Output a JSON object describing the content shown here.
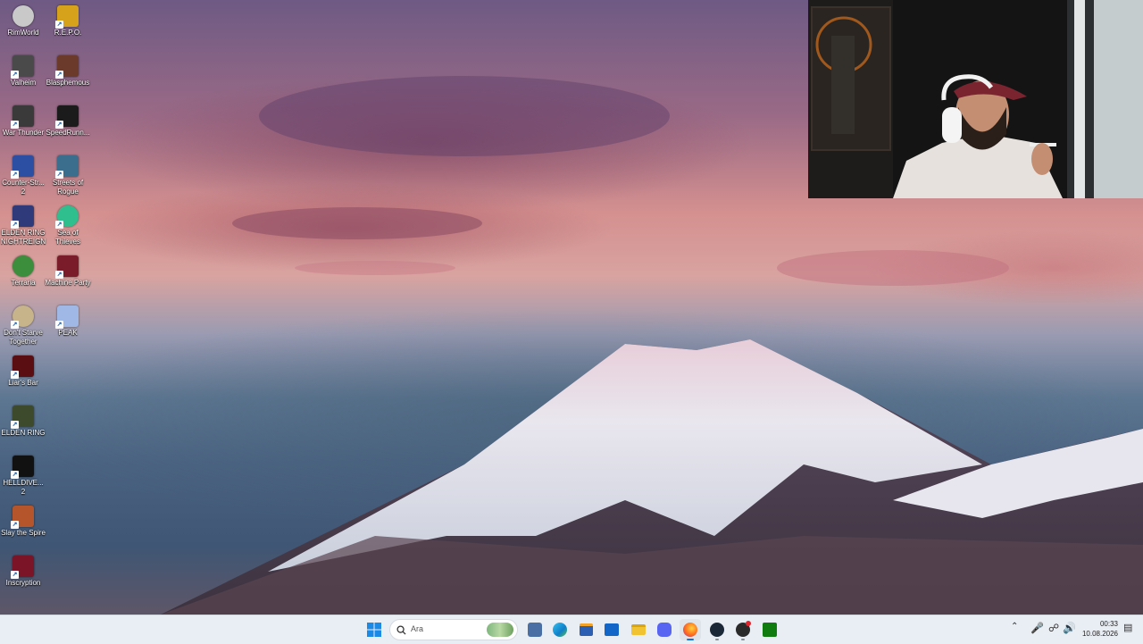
{
  "desktop": {
    "icons": [
      {
        "label": "RimWorld",
        "icon": "rimworld-icon",
        "color": "#c9c9c9"
      },
      {
        "label": "R.E.P.O.",
        "icon": "repo-icon",
        "color": "#d6a21c"
      },
      {
        "label": "Valheim",
        "icon": "valheim-icon",
        "color": "#4a4a4a"
      },
      {
        "label": "Blasphemous",
        "icon": "blasphemous-icon",
        "color": "#6b3a2a"
      },
      {
        "label": "War Thunder",
        "icon": "war-thunder-icon",
        "color": "#3a3a3a"
      },
      {
        "label": "SpeedRunn...",
        "icon": "speedrunners-icon",
        "color": "#1b1b1b"
      },
      {
        "label": "Counter-Str... 2",
        "icon": "counter-strike-icon",
        "color": "#2d4fa3"
      },
      {
        "label": "Streets of Rogue",
        "icon": "streets-of-rogue-icon",
        "color": "#3b6d8c"
      },
      {
        "label": "ELDEN RING NIGHTREIGN",
        "icon": "elden-ring-nightreign-icon",
        "color": "#2e3a7a"
      },
      {
        "label": "Sea of Thieves",
        "icon": "sea-of-thieves-icon",
        "color": "#2fbf8f"
      },
      {
        "label": "Terraria",
        "icon": "terraria-icon",
        "color": "#3c8d3c"
      },
      {
        "label": "Machine Party",
        "icon": "machine-party-icon",
        "color": "#7a1c2a"
      },
      {
        "label": "Don't Starve Together",
        "icon": "dont-starve-together-icon",
        "color": "#c8b48a"
      },
      {
        "label": "PEAK",
        "icon": "peak-icon",
        "color": "#9fb8e6"
      },
      {
        "label": "Liar's Bar",
        "icon": "liars-bar-icon",
        "color": "#5a0e12"
      },
      {
        "label": "ELDEN RING",
        "icon": "elden-ring-icon",
        "color": "#3d4a2c"
      },
      {
        "label": "HELLDIVE... 2",
        "icon": "helldivers-2-icon",
        "color": "#111111"
      },
      {
        "label": "Slay the Spire",
        "icon": "slay-the-spire-icon",
        "color": "#b5552c"
      },
      {
        "label": "Inscryption",
        "icon": "inscryption-icon",
        "color": "#7a1426"
      }
    ]
  },
  "taskbar": {
    "search_placeholder": "Ara",
    "pinned": [
      {
        "name": "widgets-icon",
        "color": "#4a6fa5"
      },
      {
        "name": "edge-icon",
        "color": "#0f7fc9"
      },
      {
        "name": "store-icon",
        "color": "#2b5fb4"
      },
      {
        "name": "outlook-icon",
        "color": "#1166c7"
      },
      {
        "name": "file-explorer-icon",
        "color": "#f1c232"
      },
      {
        "name": "discord-icon",
        "color": "#5865f2"
      },
      {
        "name": "firefox-icon",
        "color": "#ff6a1a"
      },
      {
        "name": "steam-icon",
        "color": "#1b2838"
      },
      {
        "name": "obs-icon",
        "color": "#2a2a2a"
      },
      {
        "name": "xbox-icon",
        "color": "#107c10"
      }
    ],
    "clock": {
      "time": "00:33",
      "date": "10.08.2026"
    }
  }
}
